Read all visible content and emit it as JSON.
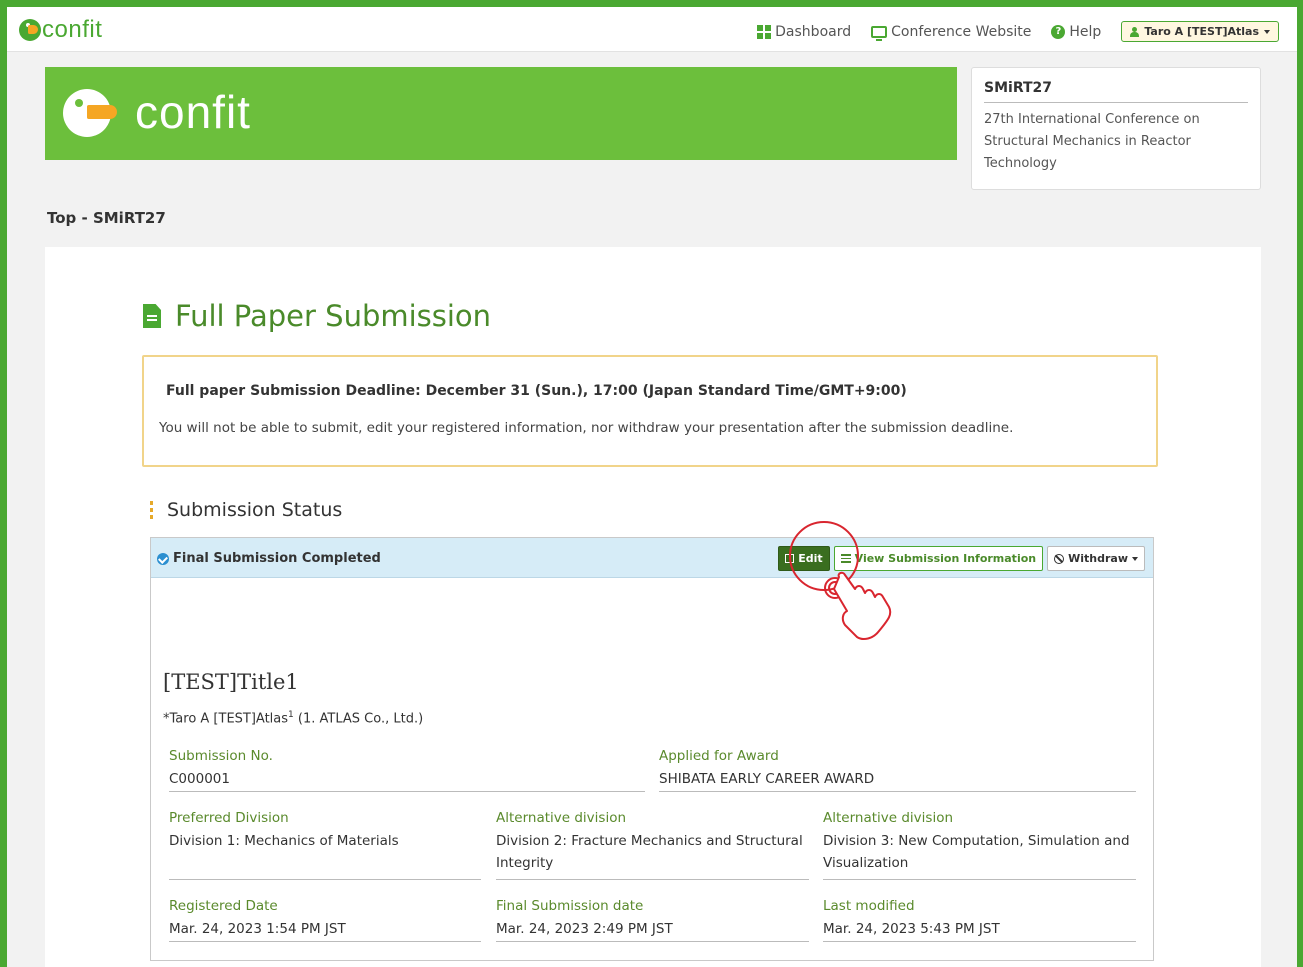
{
  "nav": {
    "brand": "confit",
    "dashboard": "Dashboard",
    "conference_website": "Conference Website",
    "help": "Help",
    "user": "Taro A [TEST]Atlas"
  },
  "banner": {
    "brand": "confit"
  },
  "conference": {
    "abbr": "SMiRT27",
    "full": "27th International Conference on Structural Mechanics in Reactor Technology"
  },
  "breadcrumb": "Top - SMiRT27",
  "page": {
    "title": "Full Paper Submission",
    "deadline": "Full paper Submission Deadline: December 31 (Sun.), 17:00 (Japan Standard Time/GMT+9:00)",
    "deadline_note": "You will not be able to submit, edit your registered information, nor withdraw your presentation after the submission deadline.",
    "section_title": "Submission Status"
  },
  "status": {
    "label": "Final Submission Completed",
    "edit": "Edit",
    "view": "View Submission Information",
    "withdraw": "Withdraw"
  },
  "submission": {
    "title": "[TEST]Title1",
    "author_prefix": "*Taro A [TEST]Atlas",
    "author_sup": "1",
    "affiliation": " (1. ATLAS Co., Ltd.)",
    "fields": {
      "submission_no": {
        "label": "Submission No.",
        "value": "C000001"
      },
      "award": {
        "label": "Applied for Award",
        "value": "SHIBATA EARLY CAREER AWARD"
      },
      "preferred": {
        "label": "Preferred Division",
        "value": "Division 1: Mechanics of Materials"
      },
      "alt1": {
        "label": "Alternative division",
        "value": "Division 2: Fracture Mechanics and Structural Integrity"
      },
      "alt2": {
        "label": "Alternative division",
        "value": "Division 3: New Computation, Simulation and Visualization"
      },
      "registered": {
        "label": "Registered Date",
        "value": "Mar. 24, 2023 1:54 PM JST"
      },
      "final": {
        "label": "Final Submission date",
        "value": "Mar. 24, 2023 2:49 PM JST"
      },
      "modified": {
        "label": "Last modified",
        "value": "Mar. 24, 2023 5:43 PM JST"
      }
    }
  },
  "colors": {
    "accent": "#4aa832",
    "highlight": "#d9262f"
  }
}
